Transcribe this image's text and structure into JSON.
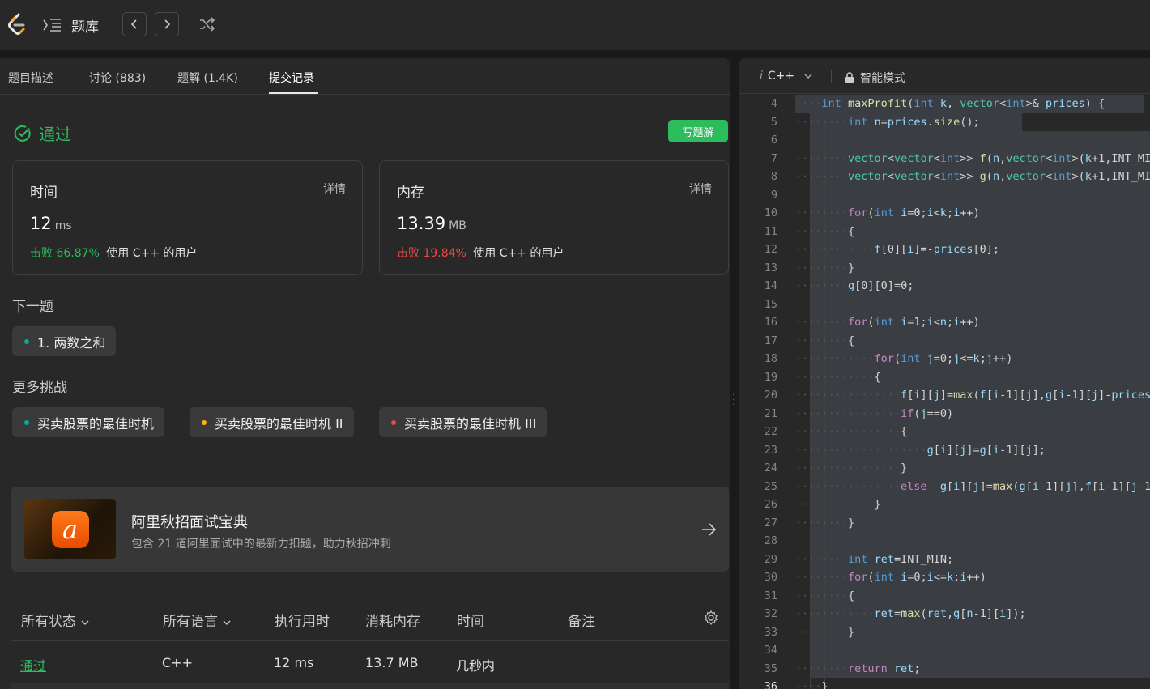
{
  "topbar": {
    "title": "题库"
  },
  "tabs": [
    {
      "label": "题目描述"
    },
    {
      "label": "讨论 (883)"
    },
    {
      "label": "题解 (1.4K)"
    },
    {
      "label": "提交记录"
    }
  ],
  "result": {
    "status": "通过",
    "write_solution": "写题解",
    "time_card": {
      "label": "时间",
      "detail": "详情",
      "value": "12",
      "unit": "ms",
      "beat": "击败 66.87%",
      "users": "使用 C++ 的用户"
    },
    "memory_card": {
      "label": "内存",
      "detail": "详情",
      "value": "13.39",
      "unit": "MB",
      "beat": "击败 19.84%",
      "users": "使用 C++ 的用户"
    }
  },
  "next_problem": {
    "title": "下一题",
    "item": "1. 两数之和"
  },
  "more_challenges": {
    "title": "更多挑战",
    "items": [
      "买卖股票的最佳时机",
      "买卖股票的最佳时机 II",
      "买卖股票的最佳时机 III"
    ]
  },
  "banner": {
    "title": "阿里秋招面试宝典",
    "subtitle": "包含 21 道阿里面试中的最新力扣题，助力秋招冲刺"
  },
  "submissions": {
    "headers": [
      "所有状态",
      "所有语言",
      "执行用时",
      "消耗内存",
      "时间",
      "备注"
    ],
    "rows": [
      {
        "status": "通过",
        "language": "C++",
        "runtime": "12 ms",
        "memory": "13.7 MB",
        "time": "几秒内"
      }
    ]
  },
  "editor": {
    "language": "C++",
    "mode": "智能模式",
    "first_line": 4,
    "current_line": 36
  },
  "colors": {
    "accent_green": "#2cbb5d",
    "hard_red": "#ef4743",
    "medium_orange": "#ffb800",
    "easy_teal": "#00af9b"
  }
}
